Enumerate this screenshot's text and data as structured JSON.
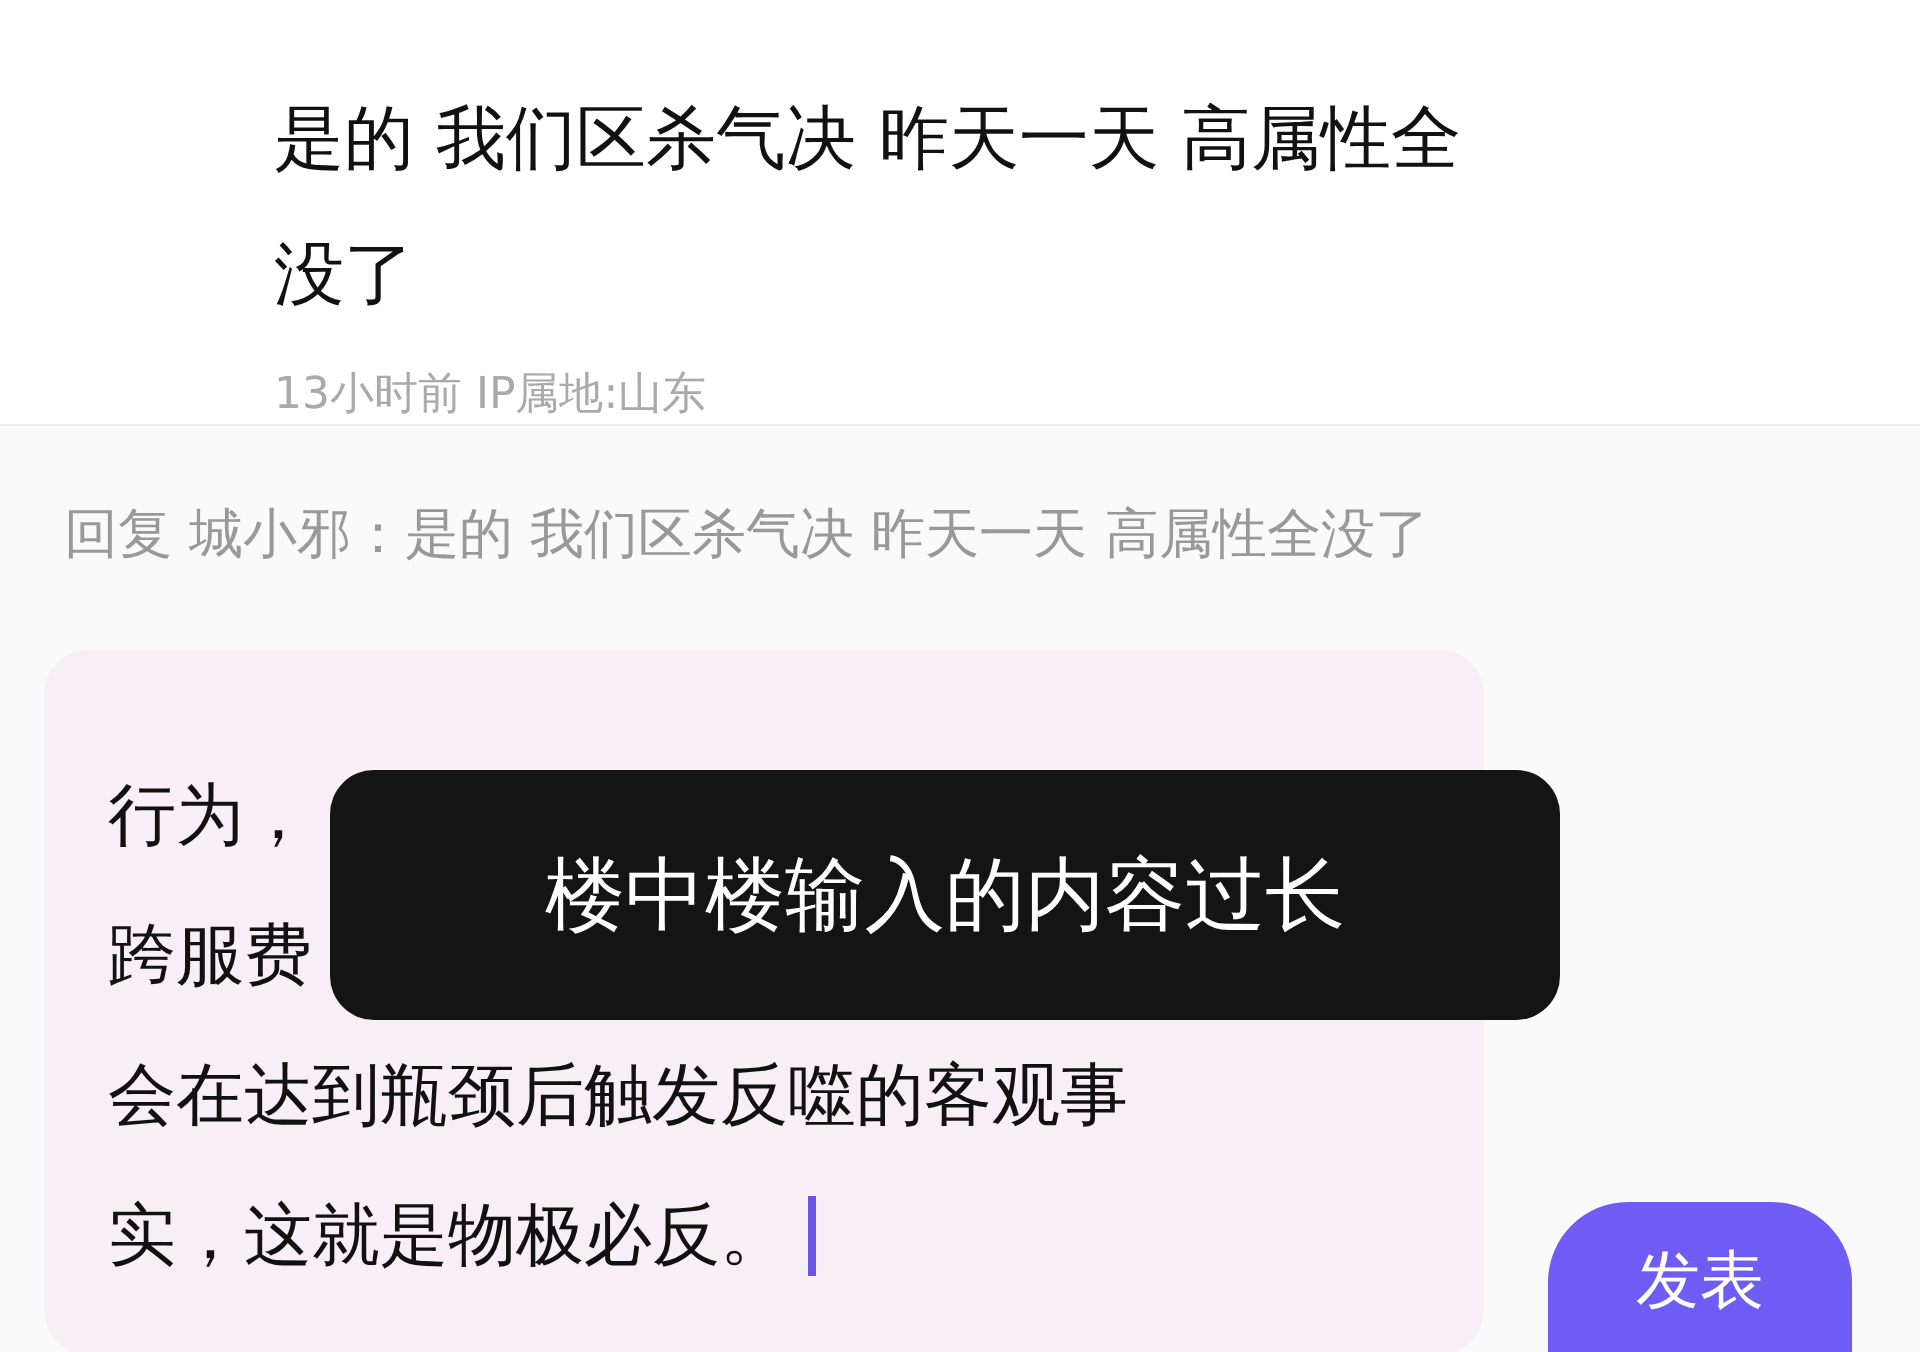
{
  "comment": {
    "text_lines": [
      "是的 我们区杀气决 昨天一天 高属性全",
      "没了"
    ],
    "meta": "13小时前  IP属地:山东"
  },
  "reply_panel": {
    "reply_to": "回复 城小邪：是的 我们区杀气决 昨天一天 高属性全没了",
    "input_lines": [
      "行为，",
      "跨服费",
      "会在达到瓶颈后触发反噬的客观事",
      "实，这就是物极必反。"
    ],
    "send_button": "发表"
  },
  "toast": "楼中楼输入的内容过长"
}
